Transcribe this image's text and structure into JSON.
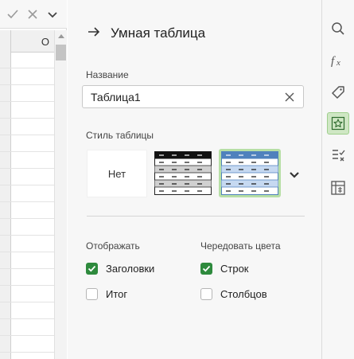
{
  "grid": {
    "column_label": "O"
  },
  "panel": {
    "title": "Умная таблица",
    "name_label": "Название",
    "name_value": "Таблица1",
    "style_label": "Стиль таблицы",
    "style_none_label": "Нет",
    "show_label": "Отображать",
    "alternate_label": "Чередовать цвета",
    "checkboxes": {
      "headers": {
        "label": "Заголовки",
        "checked": true
      },
      "total": {
        "label": "Итог",
        "checked": false
      },
      "rows": {
        "label": "Строк",
        "checked": true
      },
      "columns": {
        "label": "Столбцов",
        "checked": false
      }
    }
  },
  "toolbar": {
    "icons": [
      "search-icon",
      "function-icon",
      "tag-icon",
      "star-table-icon",
      "checklist-icon",
      "pivot-table-icon"
    ],
    "active": "star-table-icon"
  },
  "colors": {
    "accent_green": "#2e8a3d",
    "active_bg": "#cfe7c4",
    "blue_style": "#4f81bd"
  }
}
